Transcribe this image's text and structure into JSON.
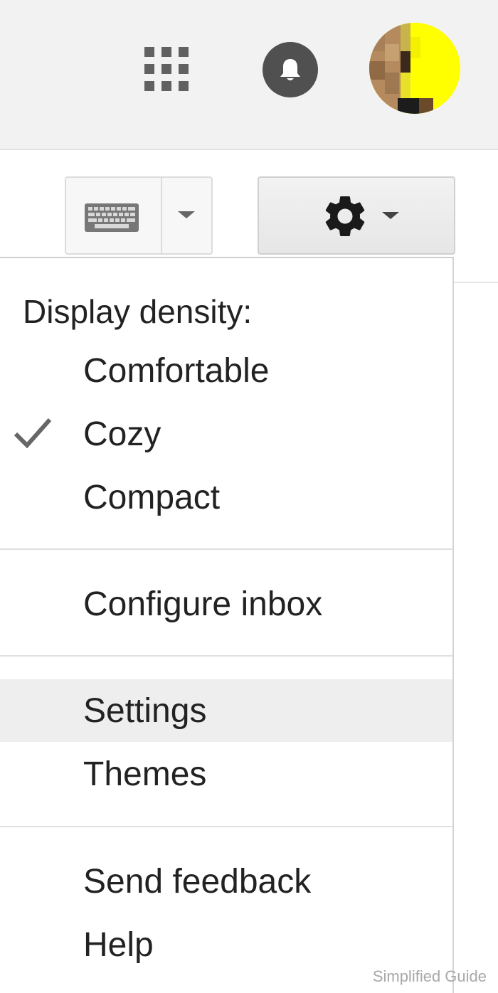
{
  "header": {
    "apps_icon": "apps-grid-icon",
    "notifications_icon": "bell-icon",
    "account_icon": "avatar"
  },
  "toolbar": {
    "input_tools_icon": "keyboard-icon",
    "input_tools_menu_icon": "chevron-down-icon",
    "settings_icon": "gear-icon",
    "settings_menu_icon": "chevron-down-icon"
  },
  "menu": {
    "density_heading": "Display density:",
    "density_options": [
      {
        "label": "Comfortable",
        "selected": false
      },
      {
        "label": "Cozy",
        "selected": true
      },
      {
        "label": "Compact",
        "selected": false
      }
    ],
    "configure_inbox": "Configure inbox",
    "settings": "Settings",
    "themes": "Themes",
    "send_feedback": "Send feedback",
    "help": "Help",
    "highlighted_item": "Settings"
  },
  "watermark": "Simplified Guide",
  "colors": {
    "header_bg": "#f2f2f2",
    "bell_bg": "#505050",
    "menu_highlight": "#eeeeee",
    "text": "#222222"
  }
}
